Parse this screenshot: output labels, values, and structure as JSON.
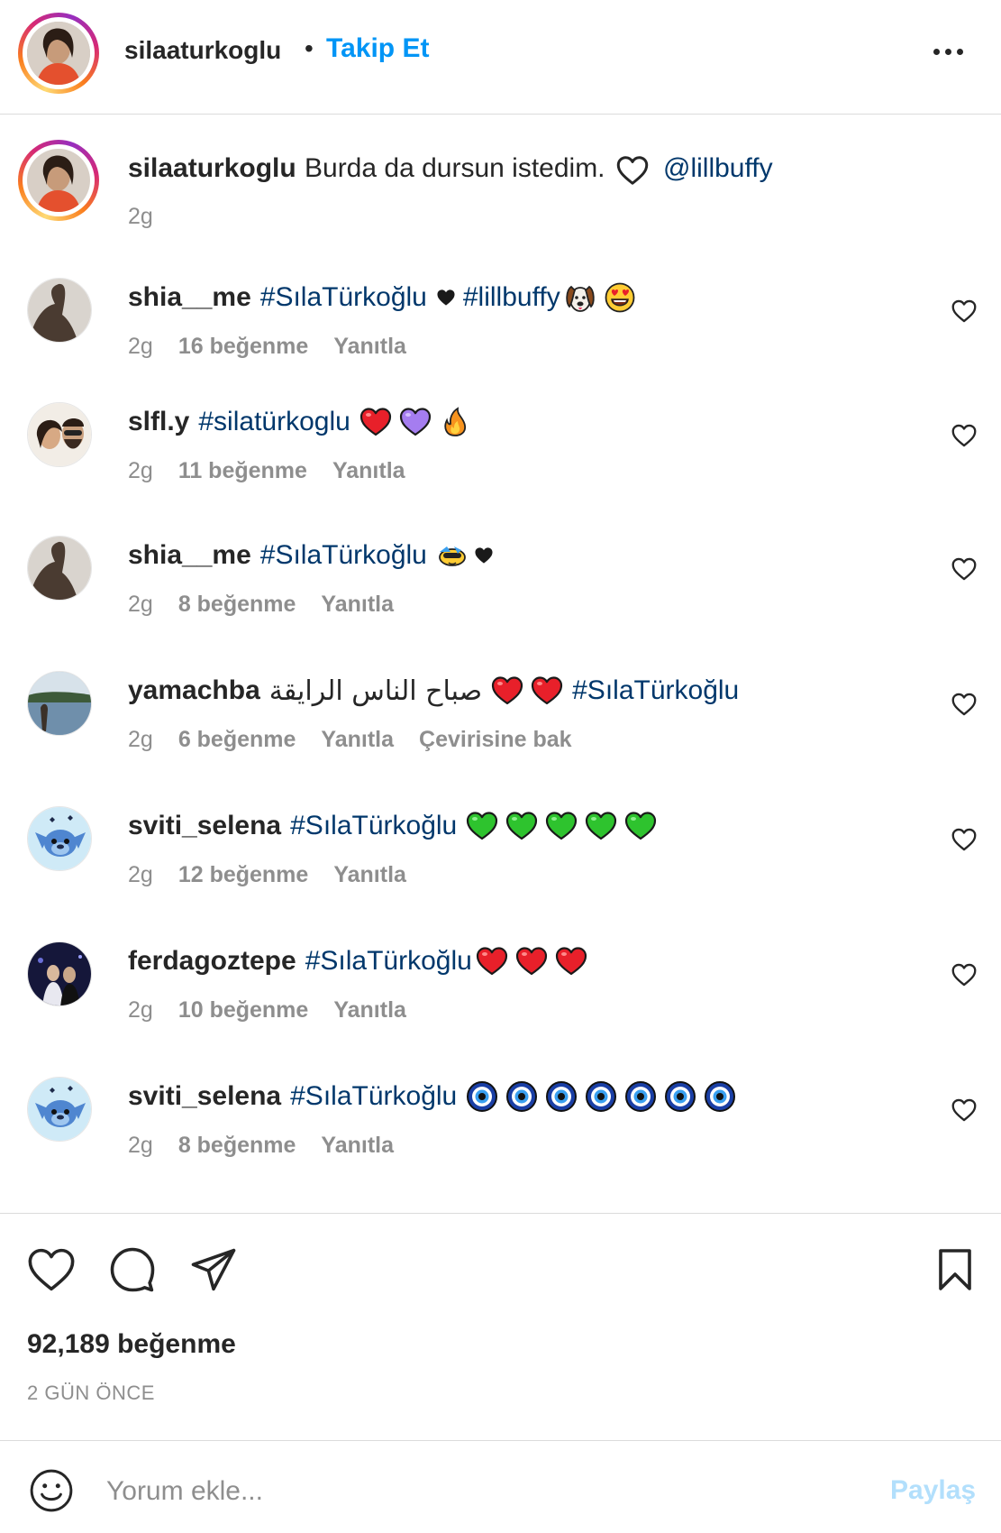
{
  "header": {
    "username": "silaaturkoglu",
    "separator": "•",
    "follow_label": "Takip Et",
    "more_icon": "more-horizontal-icon"
  },
  "caption": {
    "username": "silaaturkoglu",
    "text": "Burda da dursun istedim.",
    "mention": "@lillbuffy",
    "time": "2g"
  },
  "comments": [
    {
      "username": "shia__me",
      "tag": "#SılaTürkoğlu",
      "tag2": "#lillbuffy",
      "time": "2g",
      "likes": "16 beğenme",
      "reply": "Yanıtla"
    },
    {
      "username": "slfl.y",
      "tag": "#silatürkoglu",
      "time": "2g",
      "likes": "11 beğenme",
      "reply": "Yanıtla"
    },
    {
      "username": "shia__me",
      "tag": "#SılaTürkoğlu",
      "time": "2g",
      "likes": "8 beğenme",
      "reply": "Yanıtla"
    },
    {
      "username": "yamachba",
      "text": "صباح الناس الرايقة",
      "tag": "#SılaTürkoğlu",
      "time": "2g",
      "likes": "6 beğenme",
      "reply": "Yanıtla",
      "translate": "Çevirisine bak"
    },
    {
      "username": "sviti_selena",
      "tag": "#SılaTürkoğlu",
      "time": "2g",
      "likes": "12 beğenme",
      "reply": "Yanıtla"
    },
    {
      "username": "ferdagoztepe",
      "tag": "#SılaTürkoğlu",
      "time": "2g",
      "likes": "10 beğenme",
      "reply": "Yanıtla"
    },
    {
      "username": "sviti_selena",
      "tag": "#SılaTürkoğlu",
      "time": "2g",
      "likes": "8 beğenme",
      "reply": "Yanıtla"
    }
  ],
  "actions": {
    "like_icon": "heart-icon",
    "comment_icon": "comment-icon",
    "share_icon": "send-icon",
    "save_icon": "bookmark-icon"
  },
  "post": {
    "likes": "92,189 beğenme",
    "date": "2 GÜN ÖNCE"
  },
  "comment_box": {
    "placeholder": "Yorum ekle...",
    "share_label": "Paylaş"
  },
  "colors": {
    "accent": "#0095f6",
    "link": "#00376b",
    "muted": "#8e8e8e",
    "share_disabled": "#b2dffc"
  }
}
